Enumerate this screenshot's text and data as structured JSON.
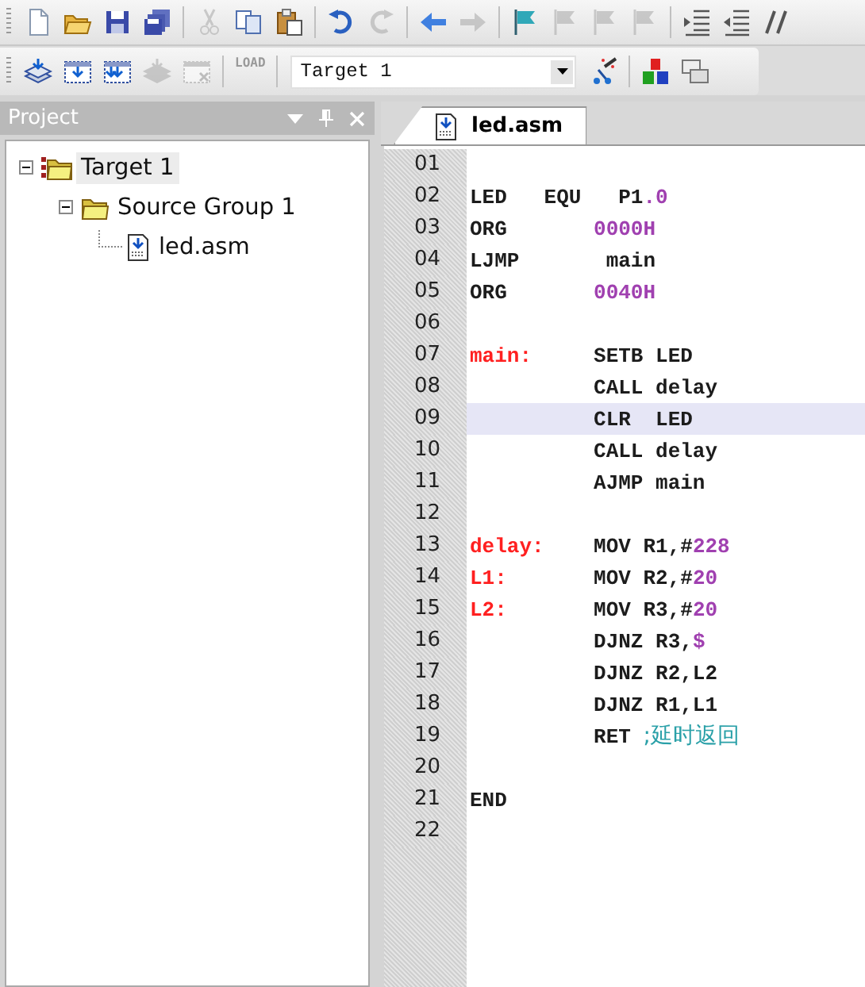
{
  "toolbar_1": [
    {
      "kind": "new",
      "disabled": false
    },
    {
      "kind": "open",
      "disabled": false
    },
    {
      "kind": "save",
      "disabled": false
    },
    {
      "kind": "save-all",
      "disabled": false
    },
    {
      "kind": "sep"
    },
    {
      "kind": "cut",
      "disabled": true
    },
    {
      "kind": "copy",
      "disabled": false
    },
    {
      "kind": "paste",
      "disabled": false
    },
    {
      "kind": "sep"
    },
    {
      "kind": "undo",
      "disabled": false
    },
    {
      "kind": "redo",
      "disabled": true
    },
    {
      "kind": "sep"
    },
    {
      "kind": "back",
      "disabled": false
    },
    {
      "kind": "forward",
      "disabled": true
    },
    {
      "kind": "sep"
    },
    {
      "kind": "flag",
      "disabled": false
    },
    {
      "kind": "flag-prev",
      "disabled": true
    },
    {
      "kind": "flag-next",
      "disabled": true
    },
    {
      "kind": "flag-clear",
      "disabled": true
    },
    {
      "kind": "sep"
    },
    {
      "kind": "indent",
      "disabled": false
    },
    {
      "kind": "unindent",
      "disabled": false
    },
    {
      "kind": "comment",
      "disabled": false
    }
  ],
  "toolbar_2": {
    "left": [
      {
        "kind": "translate",
        "disabled": false
      },
      {
        "kind": "build",
        "disabled": false
      },
      {
        "kind": "rebuild",
        "disabled": false
      },
      {
        "kind": "batch",
        "disabled": true
      },
      {
        "kind": "stop",
        "disabled": true
      }
    ],
    "load_button": {
      "label": "LOAD",
      "disabled": true
    },
    "target_select": {
      "value": "Target 1"
    },
    "right": [
      {
        "kind": "wand",
        "disabled": false
      },
      {
        "kind": "sep"
      },
      {
        "kind": "components",
        "disabled": false
      },
      {
        "kind": "windows",
        "disabled": false
      }
    ]
  },
  "project_panel": {
    "title": "Project",
    "tree": [
      {
        "label": "Target 1",
        "kind": "target",
        "expanded": true,
        "selected": true,
        "children": [
          {
            "label": "Source Group 1",
            "kind": "group",
            "expanded": true,
            "selected": false,
            "children": [
              {
                "label": "led.asm",
                "kind": "file",
                "selected": false
              }
            ]
          }
        ]
      }
    ]
  },
  "editor": {
    "tabs": [
      {
        "label": "led.asm",
        "selected": true
      }
    ],
    "lines": [
      {
        "number": "01",
        "current": false
      },
      {
        "number": "02",
        "current": false,
        "tokens": [
          {
            "kind": "code",
            "text": "LED   EQU   P1"
          },
          {
            "kind": "number",
            "text": ".0"
          }
        ]
      },
      {
        "number": "03",
        "current": false,
        "tokens": [
          {
            "kind": "code",
            "text": "ORG       "
          },
          {
            "kind": "number",
            "text": "0000H"
          }
        ]
      },
      {
        "number": "04",
        "current": false,
        "tokens": [
          {
            "kind": "code",
            "text": "LJMP       main"
          }
        ]
      },
      {
        "number": "05",
        "current": false,
        "tokens": [
          {
            "kind": "code",
            "text": "ORG       "
          },
          {
            "kind": "number",
            "text": "0040H"
          }
        ]
      },
      {
        "number": "06",
        "current": false
      },
      {
        "number": "07",
        "current": false,
        "tokens": [
          {
            "kind": "label",
            "text": "main:     "
          },
          {
            "kind": "code",
            "text": "SETB LED"
          }
        ]
      },
      {
        "number": "08",
        "current": false,
        "tokens": [
          {
            "kind": "code",
            "text": "          CALL delay"
          }
        ]
      },
      {
        "number": "09",
        "current": true,
        "tokens": [
          {
            "kind": "code",
            "text": "          CLR  LED"
          }
        ]
      },
      {
        "number": "10",
        "current": false,
        "tokens": [
          {
            "kind": "code",
            "text": "          CALL delay"
          }
        ]
      },
      {
        "number": "11",
        "current": false,
        "tokens": [
          {
            "kind": "code",
            "text": "          AJMP main"
          }
        ]
      },
      {
        "number": "12",
        "current": false
      },
      {
        "number": "13",
        "current": false,
        "tokens": [
          {
            "kind": "label",
            "text": "delay:    "
          },
          {
            "kind": "code",
            "text": "MOV R1,#"
          },
          {
            "kind": "number",
            "text": "228"
          }
        ]
      },
      {
        "number": "14",
        "current": false,
        "tokens": [
          {
            "kind": "label",
            "text": "L1:       "
          },
          {
            "kind": "code",
            "text": "MOV R2,#"
          },
          {
            "kind": "number",
            "text": "20"
          }
        ]
      },
      {
        "number": "15",
        "current": false,
        "tokens": [
          {
            "kind": "label",
            "text": "L2:       "
          },
          {
            "kind": "code",
            "text": "MOV R3,#"
          },
          {
            "kind": "number",
            "text": "20"
          }
        ]
      },
      {
        "number": "16",
        "current": false,
        "tokens": [
          {
            "kind": "code",
            "text": "          DJNZ R3,"
          },
          {
            "kind": "number",
            "text": "$"
          }
        ]
      },
      {
        "number": "17",
        "current": false,
        "tokens": [
          {
            "kind": "code",
            "text": "          DJNZ R2,L2"
          }
        ]
      },
      {
        "number": "18",
        "current": false,
        "tokens": [
          {
            "kind": "code",
            "text": "          DJNZ R1,L1"
          }
        ]
      },
      {
        "number": "19",
        "current": false,
        "tokens": [
          {
            "kind": "code",
            "text": "          RET "
          },
          {
            "kind": "comment",
            "text": ";延时返回"
          }
        ]
      },
      {
        "number": "20",
        "current": false
      },
      {
        "number": "21",
        "current": false,
        "tokens": [
          {
            "kind": "code",
            "text": "END"
          }
        ]
      },
      {
        "number": "22",
        "current": false
      }
    ]
  }
}
